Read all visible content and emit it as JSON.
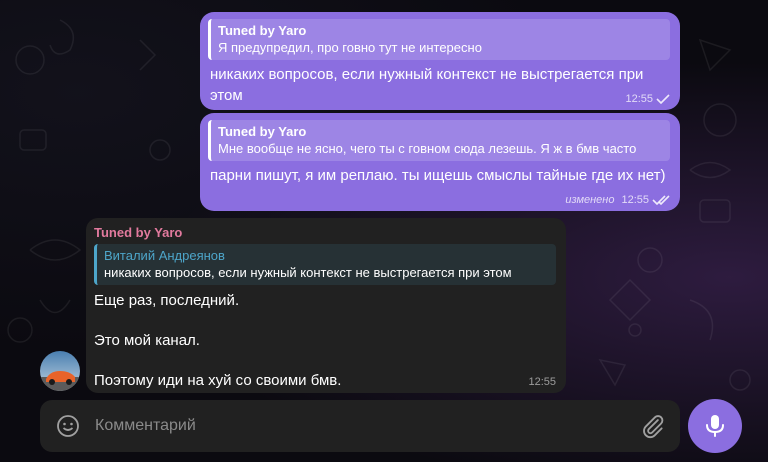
{
  "messages": [
    {
      "reply_author": "Tuned by Yaro",
      "reply_text": "Я предупредил, про говно тут не интересно",
      "text": "никаких вопросов, если нужный контекст не выстрегается при этом",
      "time": "12:55",
      "status_icon": "single-check-icon"
    },
    {
      "reply_author": "Tuned by Yaro",
      "reply_text": "Мне вообще не ясно, чего ты с говном сюда лезешь. Я ж в бмв часто",
      "text": "парни пишут, я им реплаю. ты ищешь смыслы тайные где их нет)",
      "edited_label": "изменено",
      "time": "12:55",
      "status_icon": "double-check-icon"
    }
  ],
  "incoming": {
    "sender": "Tuned by Yaro",
    "reply_author": "Виталий Андреянов",
    "reply_text": "никаких вопросов, если нужный контекст не выстрегается при этом",
    "lines": [
      "Еще раз, последний.",
      "Это мой канал.",
      "Поэтому иди на хуй со своими бмв."
    ],
    "time": "12:55"
  },
  "composer": {
    "placeholder": "Комментарий"
  },
  "colors": {
    "outgoing_bubble": "#8b6ee0",
    "incoming_bubble": "#212121",
    "sender_name": "#e27a9e",
    "reply_accent": "#4da5c9",
    "background": "#0b0a10"
  }
}
